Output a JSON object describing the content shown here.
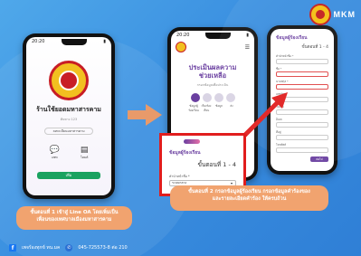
{
  "brand": {
    "name": "MKM"
  },
  "phone1": {
    "time": "20:20",
    "name": "ร้านใช้ยอดมหาสารคาม",
    "subtitle": "ต้นทาง 123",
    "pill": "ลงทะเบียนมหาสารคาม",
    "icons": [
      {
        "icon": "chat-icon",
        "label": "แชท"
      },
      {
        "icon": "home-icon",
        "label": "โฮมต์"
      }
    ],
    "add_button": "เพิ่ม"
  },
  "phone2": {
    "time": "20:20",
    "title_line1": "ประเมินผลความ",
    "title_line2": "ช่วยเหลือ",
    "desc": "กรอกข้อมูลเพื่อประเมิน",
    "tabs": [
      "ข้อมูลผู้ร้องเรียน",
      "เรื่องร้องเรียน",
      "ข้อมูล",
      "ส่ง"
    ]
  },
  "zoom": {
    "title": "ข้อมูลผู้ร้องเรียน",
    "step": "ขั้นตอนที่ 1 - 4",
    "field_label": "คำนำหน้าชื่อ *",
    "field_value": "ระบบกลาง"
  },
  "phone3": {
    "title": "ข้อมูลผู้ร้องเรียน",
    "step": "ขั้นตอนที่ 1 - 4",
    "fields": [
      "คำนำหน้าชื่อ *",
      "ชื่อ *",
      "นามสกุล *",
      "เลขบัตร",
      "วันเกิด",
      "อีเมล",
      "ที่อยู่",
      "โทรศัพท์"
    ],
    "button": "ต่อไป"
  },
  "captions": {
    "step1_line1": "ขั้นตอนที่ 1 เข้าสู่ Line OA โดยเพิ่มเป็น",
    "step1_line2": "เพื่อนของเทศบาลเมืองมหาสารคาม",
    "step2_line1": "ขั้นตอนที่ 2 กรอกข้อมูลผู้ร้องเรียน กรอกข้อมูลคำร้องของ",
    "step2_line2": "และรายละเอียดคำร้อง ให้ครบถ้วน"
  },
  "footer": {
    "facebook": "เพจร้องทุกข์ ทน.มค",
    "phone": "045-725573-8 ต่อ 210"
  }
}
